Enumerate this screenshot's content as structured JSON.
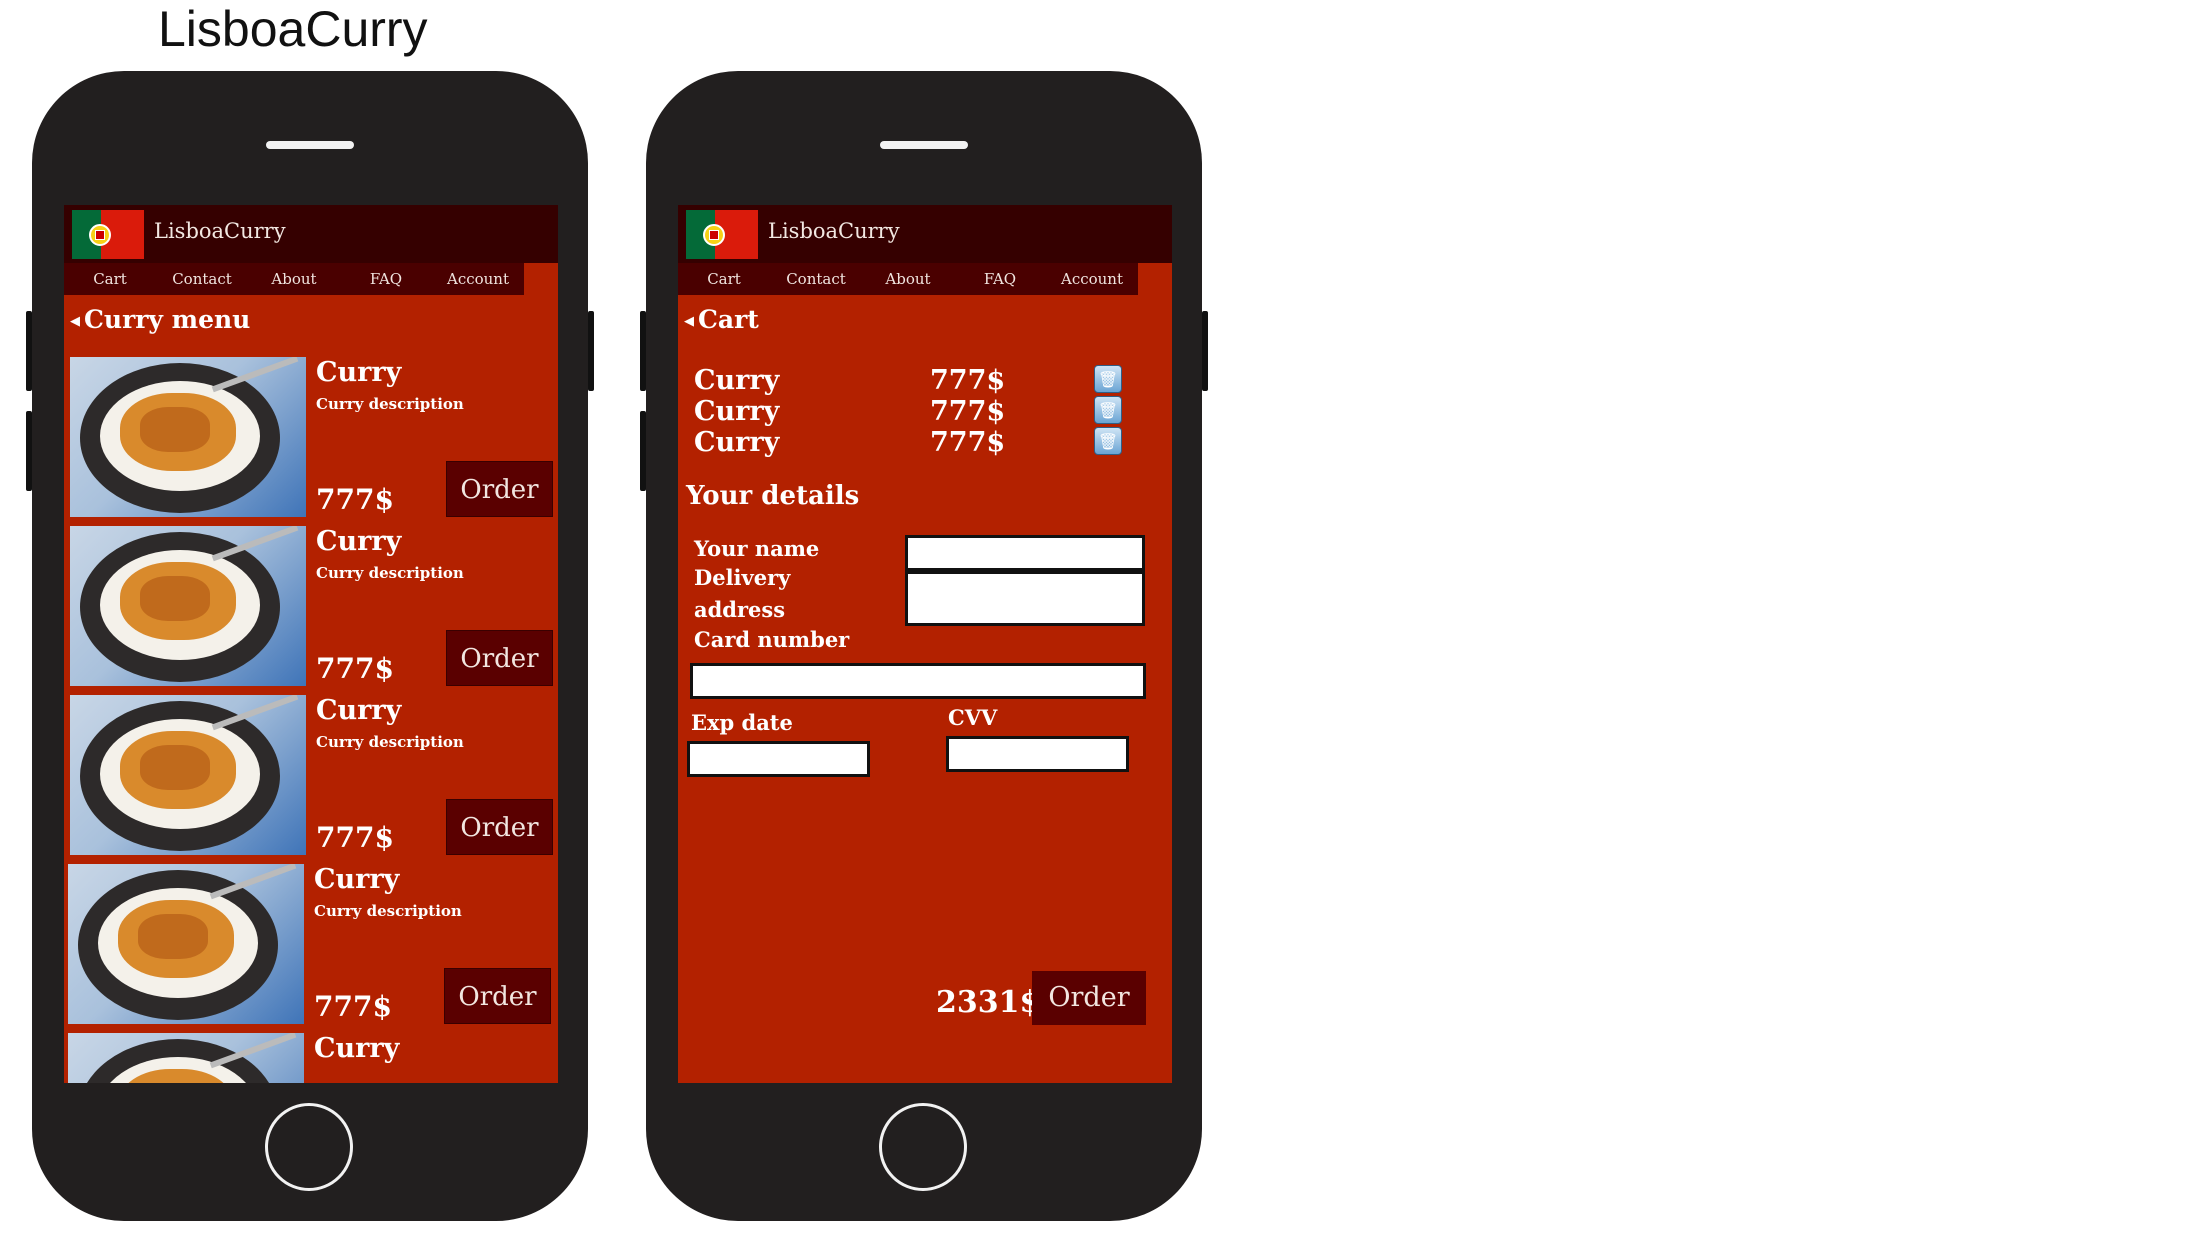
{
  "page": {
    "title": "LisboaCurry"
  },
  "app": {
    "brand": "LisboaCurry",
    "nav": [
      "Cart",
      "Contact",
      "About",
      "FAQ",
      "Account"
    ],
    "colors": {
      "background": "#b32100",
      "appbar": "#350000",
      "nav": "#4a0000",
      "button": "#5a0000"
    }
  },
  "menu_screen": {
    "back_label": "Curry menu",
    "items": [
      {
        "name": "Curry",
        "description": "Curry description",
        "price": "777$",
        "order_label": "Order"
      },
      {
        "name": "Curry",
        "description": "Curry description",
        "price": "777$",
        "order_label": "Order"
      },
      {
        "name": "Curry",
        "description": "Curry description",
        "price": "777$",
        "order_label": "Order"
      },
      {
        "name": "Curry",
        "description": "Curry description",
        "price": "777$",
        "order_label": "Order"
      },
      {
        "name": "Curry"
      }
    ]
  },
  "cart_screen": {
    "back_label": "Cart",
    "items": [
      {
        "name": "Curry",
        "price": "777$",
        "icon": "trash-icon"
      },
      {
        "name": "Curry",
        "price": "777$",
        "icon": "trash-icon"
      },
      {
        "name": "Curry",
        "price": "777$",
        "icon": "trash-icon"
      }
    ],
    "details_title": "Your details",
    "labels": {
      "your_name": "Your name",
      "delivery_address_1": "Delivery",
      "delivery_address_2": "address",
      "card_number": "Card number",
      "exp_date": "Exp date",
      "cvv": "CVV"
    },
    "total": "2331$",
    "order_label": "Order"
  }
}
